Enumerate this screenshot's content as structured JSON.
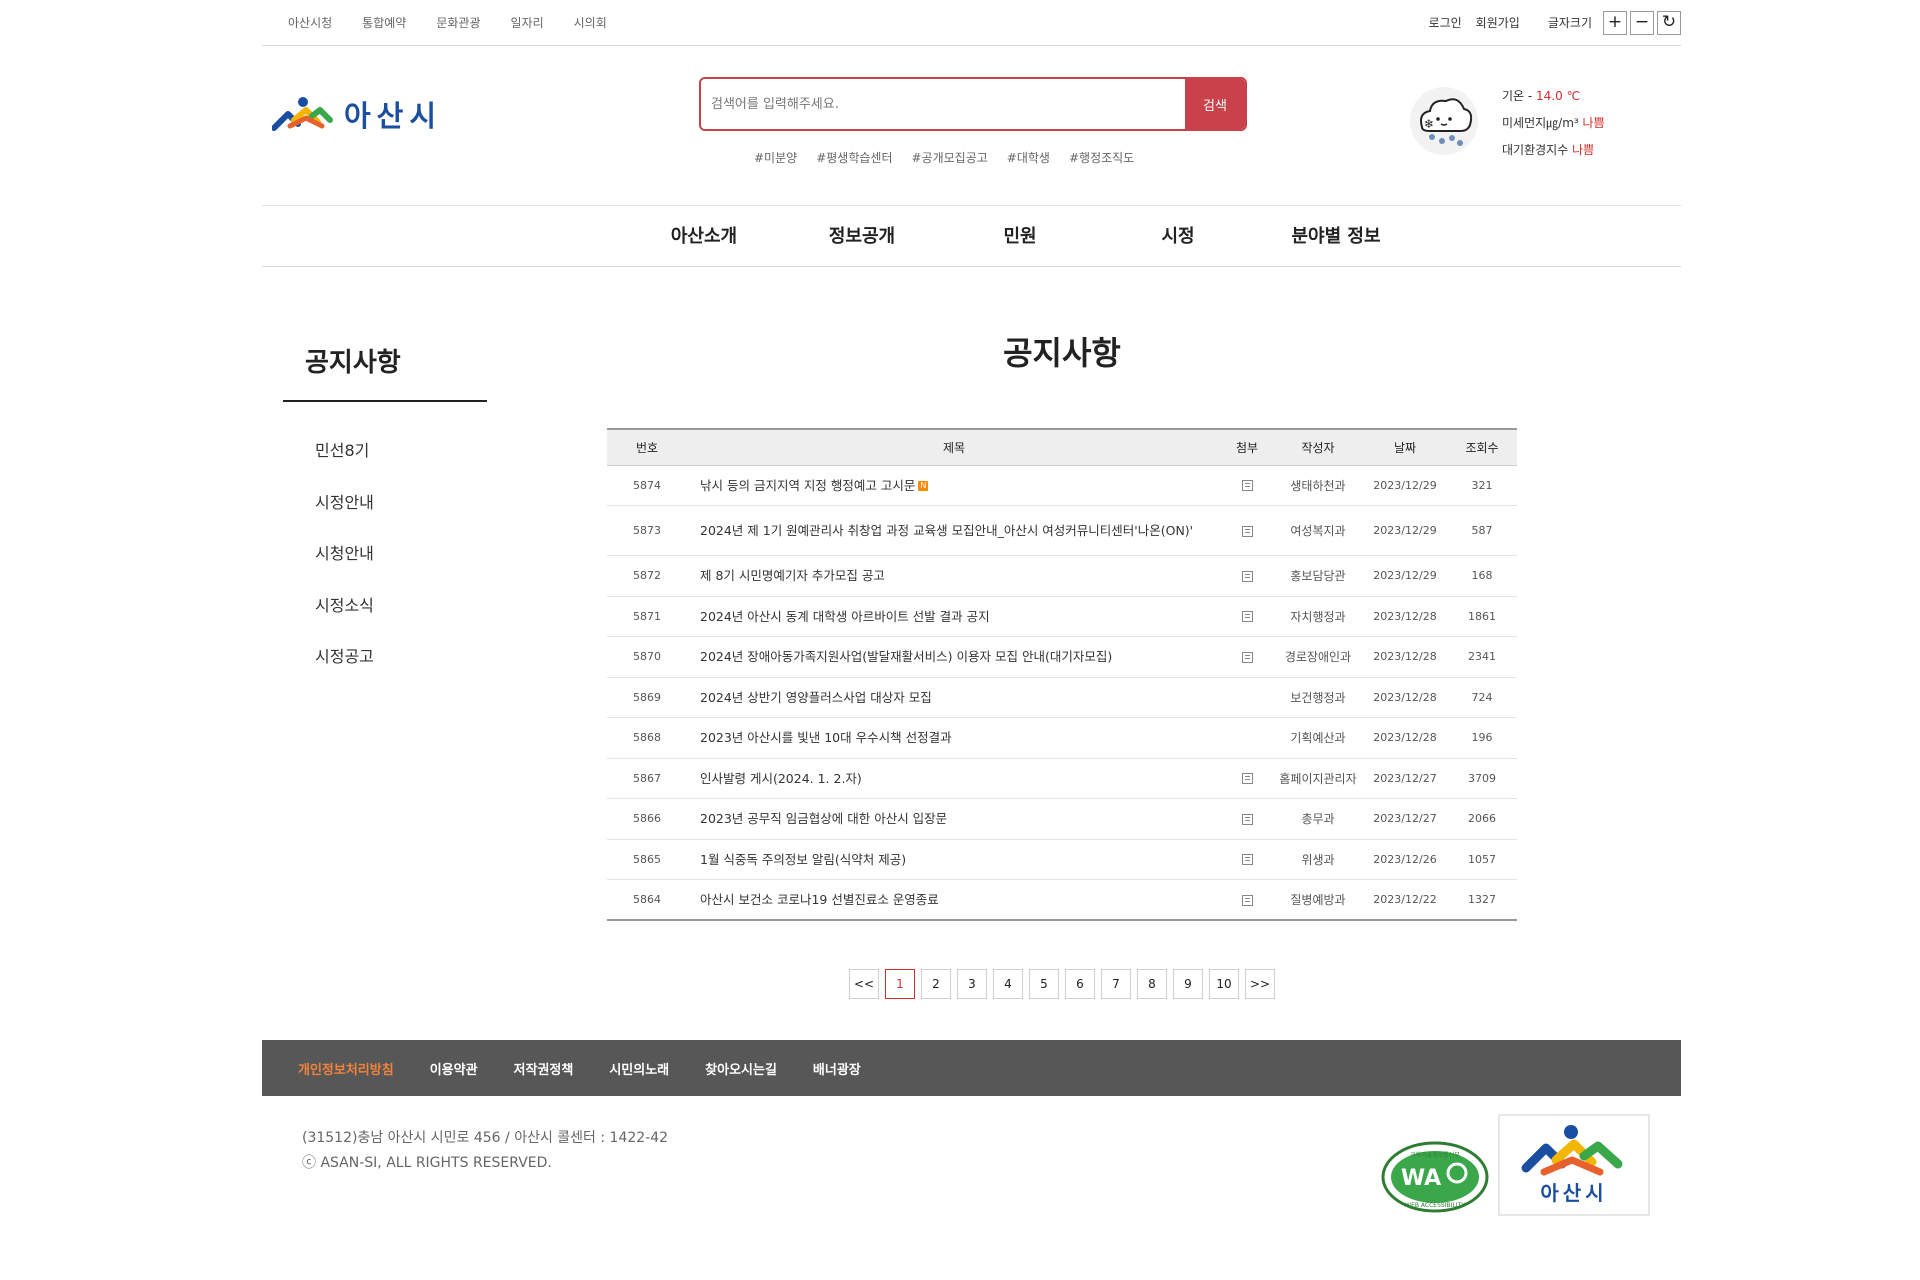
{
  "topbar": {
    "links": [
      "아산시청",
      "통합예약",
      "문화관광",
      "일자리",
      "시의회"
    ],
    "login": "로그인",
    "join": "회원가입",
    "font_size_label": "글자크기",
    "zoom_in": "+",
    "zoom_out": "−",
    "reset": "↻"
  },
  "header": {
    "logo_text": "아산시",
    "search": {
      "placeholder": "검색어를 입력해주세요.",
      "button": "검색"
    },
    "tags": [
      "#미분양",
      "#평생학습센터",
      "#공개모집공고",
      "#대학생",
      "#행정조직도"
    ],
    "weather": {
      "icon": "snow-cloud-icon",
      "temp_label": "기온 - ",
      "temp_value": "14.0 ℃",
      "dust_label": "미세먼지㎍/m³ ",
      "dust_value": "나쁨",
      "air_label": "대기환경지수 ",
      "air_value": "나쁨"
    }
  },
  "gnb": [
    "아산소개",
    "정보공개",
    "민원",
    "시정",
    "분야별 정보"
  ],
  "lnb": {
    "title": "공지사항",
    "items": [
      "민선8기",
      "시정안내",
      "시청안내",
      "시정소식",
      "시정공고"
    ]
  },
  "board": {
    "title": "공지사항",
    "columns": [
      "번호",
      "제목",
      "첨부",
      "작성자",
      "날짜",
      "조회수"
    ],
    "rows": [
      {
        "no": "5874",
        "title": "낚시 등의 금지지역 지정 행정예고 고시문",
        "new": "N",
        "file": true,
        "writer": "생태하천과",
        "date": "2023/12/29",
        "views": "321"
      },
      {
        "no": "5873",
        "title": "2024년 제 1기 원예관리사 취창업 과정 교육생 모집안내_아산시 여성커뮤니티센터'나온(ON)'",
        "file": true,
        "writer": "여성복지과",
        "date": "2023/12/29",
        "views": "587"
      },
      {
        "no": "5872",
        "title": "제 8기 시민명예기자 추가모집 공고",
        "file": true,
        "writer": "홍보담당관",
        "date": "2023/12/29",
        "views": "168"
      },
      {
        "no": "5871",
        "title": "2024년 아산시 동계 대학생 아르바이트 선발 결과 공지",
        "file": true,
        "writer": "자치행정과",
        "date": "2023/12/28",
        "views": "1861"
      },
      {
        "no": "5870",
        "title": "2024년 장애아동가족지원사업(발달재활서비스) 이용자 모집 안내(대기자모집)",
        "file": true,
        "writer": "경로장애인과",
        "date": "2023/12/28",
        "views": "2341"
      },
      {
        "no": "5869",
        "title": "2024년 상반기 영양플러스사업 대상자 모집",
        "file": false,
        "writer": "보건행정과",
        "date": "2023/12/28",
        "views": "724"
      },
      {
        "no": "5868",
        "title": "2023년 아산시를 빛낸 10대 우수시책 선정결과",
        "file": false,
        "writer": "기획예산과",
        "date": "2023/12/28",
        "views": "196"
      },
      {
        "no": "5867",
        "title": "인사발령 게시(2024. 1. 2.자)",
        "file": true,
        "writer": "홈페이지관리자",
        "date": "2023/12/27",
        "views": "3709"
      },
      {
        "no": "5866",
        "title": "2023년 공무직 임금협상에 대한 아산시 입장문",
        "file": true,
        "writer": "총무과",
        "date": "2023/12/27",
        "views": "2066"
      },
      {
        "no": "5865",
        "title": "1월 식중독 주의정보 알림(식약처 제공)",
        "file": true,
        "writer": "위생과",
        "date": "2023/12/26",
        "views": "1057"
      },
      {
        "no": "5864",
        "title": "아산시 보건소 코로나19 선별진료소 운영종료",
        "file": true,
        "writer": "질병예방과",
        "date": "2023/12/22",
        "views": "1327"
      }
    ]
  },
  "pagination": {
    "prev": "<<",
    "pages": [
      "1",
      "2",
      "3",
      "4",
      "5",
      "6",
      "7",
      "8",
      "9",
      "10"
    ],
    "current": "1",
    "next": ">>"
  },
  "footer": {
    "links": [
      "개인정보처리방침",
      "이용약관",
      "저작권정책",
      "시민의노래",
      "찾아오시는길",
      "배너광장"
    ],
    "address": "(31512)충남 아산시 시민로 456 / 아산시 콜센터 : 1422-42",
    "copyright": "ⓒ ASAN-SI, ALL RIGHTS RESERVED.",
    "wa_mark": "WA",
    "wa_top": "과학기술정보통신부",
    "wa_bottom": "WEB ACCESSIBILITY",
    "logo_text": "아산시"
  },
  "colors": {
    "accent_red": "#c9414a",
    "alert_red": "#d42d2d",
    "footer_bar": "#575757",
    "footer_highlight": "#f0823d",
    "brand_blue": "#1a4ea0",
    "brand_green": "#3aa84a",
    "brand_yellow": "#f2b705",
    "brand_orange": "#e8602c"
  }
}
